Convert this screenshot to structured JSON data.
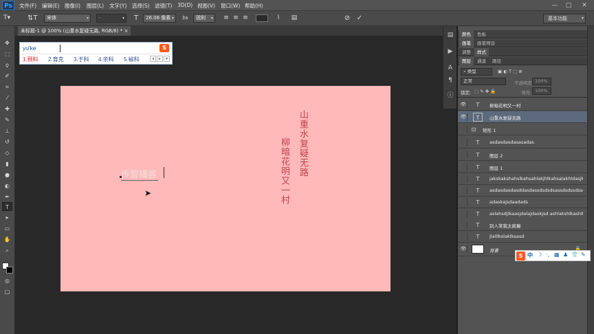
{
  "app": {
    "logo": "Ps"
  },
  "menu": [
    "文件(F)",
    "编辑(E)",
    "图像(I)",
    "图层(L)",
    "文字(Y)",
    "选择(S)",
    "滤镜(T)",
    "3D(D)",
    "视图(V)",
    "窗口(W)",
    "帮助(H)"
  ],
  "window_controls": [
    "—",
    "□",
    "✕"
  ],
  "options": {
    "font_family": "宋体",
    "font_style": "-",
    "font_size": "26.06 像素",
    "aa_label": "a",
    "aa_prefix": "3",
    "aa_mode": "锐利",
    "workspace": "基本功能"
  },
  "document": {
    "tab_title": "未标题-1 @ 100% (山重水复疑无路, RGB/8) *",
    "close": "×"
  },
  "canvas": {
    "vertical_texts": [
      "山重水复疑无路",
      "柳暗花明又一村"
    ],
    "editing_text": "传智播客",
    "bg_color": "#ffb9b9",
    "text_color": "#c0454e"
  },
  "ime": {
    "input": "yu'ke",
    "logo": "S",
    "candidates": [
      "1.预料",
      "2.育克",
      "3.于科",
      "4.余科",
      "5.榆科"
    ],
    "nav": [
      "◂",
      "▸",
      "▾"
    ]
  },
  "panels": {
    "color_tabs": [
      "颜色",
      "色板"
    ],
    "brush_tabs": [
      "画笔",
      "画笔预设"
    ],
    "adjust_tabs": [
      "调整",
      "样式"
    ],
    "layer_tabs": [
      "图层",
      "通道",
      "路径"
    ],
    "filter_kind": "类型",
    "blend_mode": "正常",
    "opacity_label": "不透明度:",
    "opacity_value": "100%",
    "lock_label": "锁定:",
    "fill_label": "填充:",
    "fill_value": "100%"
  },
  "layers": [
    {
      "name": "柳暗花明又一村",
      "type": "T",
      "visible": true,
      "selected": false
    },
    {
      "name": "山重水复疑无路",
      "type": "T",
      "visible": true,
      "selected": true
    },
    {
      "name": "矩形 1",
      "type": "shape",
      "visible": false,
      "selected": false
    },
    {
      "name": "asdasdasdasasadas",
      "type": "T",
      "visible": false,
      "selected": false
    },
    {
      "name": "图层 2",
      "type": "T",
      "visible": false,
      "selected": false
    },
    {
      "name": "图层 1",
      "type": "T",
      "visible": false,
      "selected": false
    },
    {
      "name": "jakskakshahslkahsahlakjhlkahsalakhldasjk",
      "type": "T",
      "visible": false,
      "selected": false
    },
    {
      "name": "asdasdasdasddasdassdsdsdsassdsdssdssdasd",
      "type": "T",
      "visible": false,
      "selected": false
    },
    {
      "name": "adaskajsdaadads",
      "type": "T",
      "visible": false,
      "selected": false
    },
    {
      "name": "aslahsdjlkaasjdalajdaskjsd ashlakshlkashlk",
      "type": "T",
      "visible": false,
      "selected": false
    },
    {
      "name": "别人笑我太疯癫",
      "type": "T",
      "visible": false,
      "selected": false
    },
    {
      "name": "jlalllkslaklkaasd",
      "type": "T",
      "visible": false,
      "selected": false
    },
    {
      "name": "背景",
      "type": "bg",
      "visible": true,
      "selected": false
    }
  ],
  "sogou_bar": {
    "logo": "S",
    "items": [
      "中",
      "☽",
      "·,",
      "▦",
      "♟",
      "👕",
      "✎"
    ]
  }
}
